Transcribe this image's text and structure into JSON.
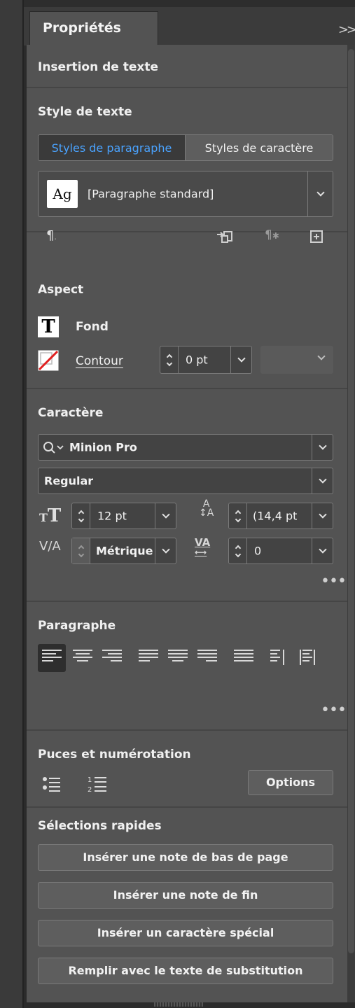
{
  "panel": {
    "tab_label": "Propriétés",
    "collapse_icon": "double-chevron-right-icon"
  },
  "insertion": {
    "title": "Insertion de texte"
  },
  "text_style": {
    "title": "Style de texte",
    "tabs": [
      {
        "label": "Styles de paragraphe",
        "active": true
      },
      {
        "label": "Styles de caractère",
        "active": false
      }
    ],
    "preview_glyph": "Ag",
    "selected_style": "[Paragraphe standard]"
  },
  "aspect": {
    "title": "Aspect",
    "fill_label": "Fond",
    "stroke_label": "Contour",
    "stroke_weight": "0 pt"
  },
  "character": {
    "title": "Caractère",
    "font_family": "Minion Pro",
    "font_style": "Regular",
    "font_size": "12 pt",
    "leading": "(14,4 pt",
    "kerning": "Métrique",
    "tracking": "0"
  },
  "paragraph": {
    "title": "Paragraphe",
    "active_alignment": 0
  },
  "bullets": {
    "title": "Puces et numérotation",
    "options_label": "Options"
  },
  "quick": {
    "title": "Sélections rapides",
    "actions": [
      "Insérer une note de bas de page",
      "Insérer une note de fin",
      "Insérer un caractère spécial",
      "Remplir avec le texte de substitution"
    ]
  },
  "colors": {
    "panel_bg": "#535353",
    "accent": "#4aa3ff",
    "stroke_slash": "#e02020"
  }
}
